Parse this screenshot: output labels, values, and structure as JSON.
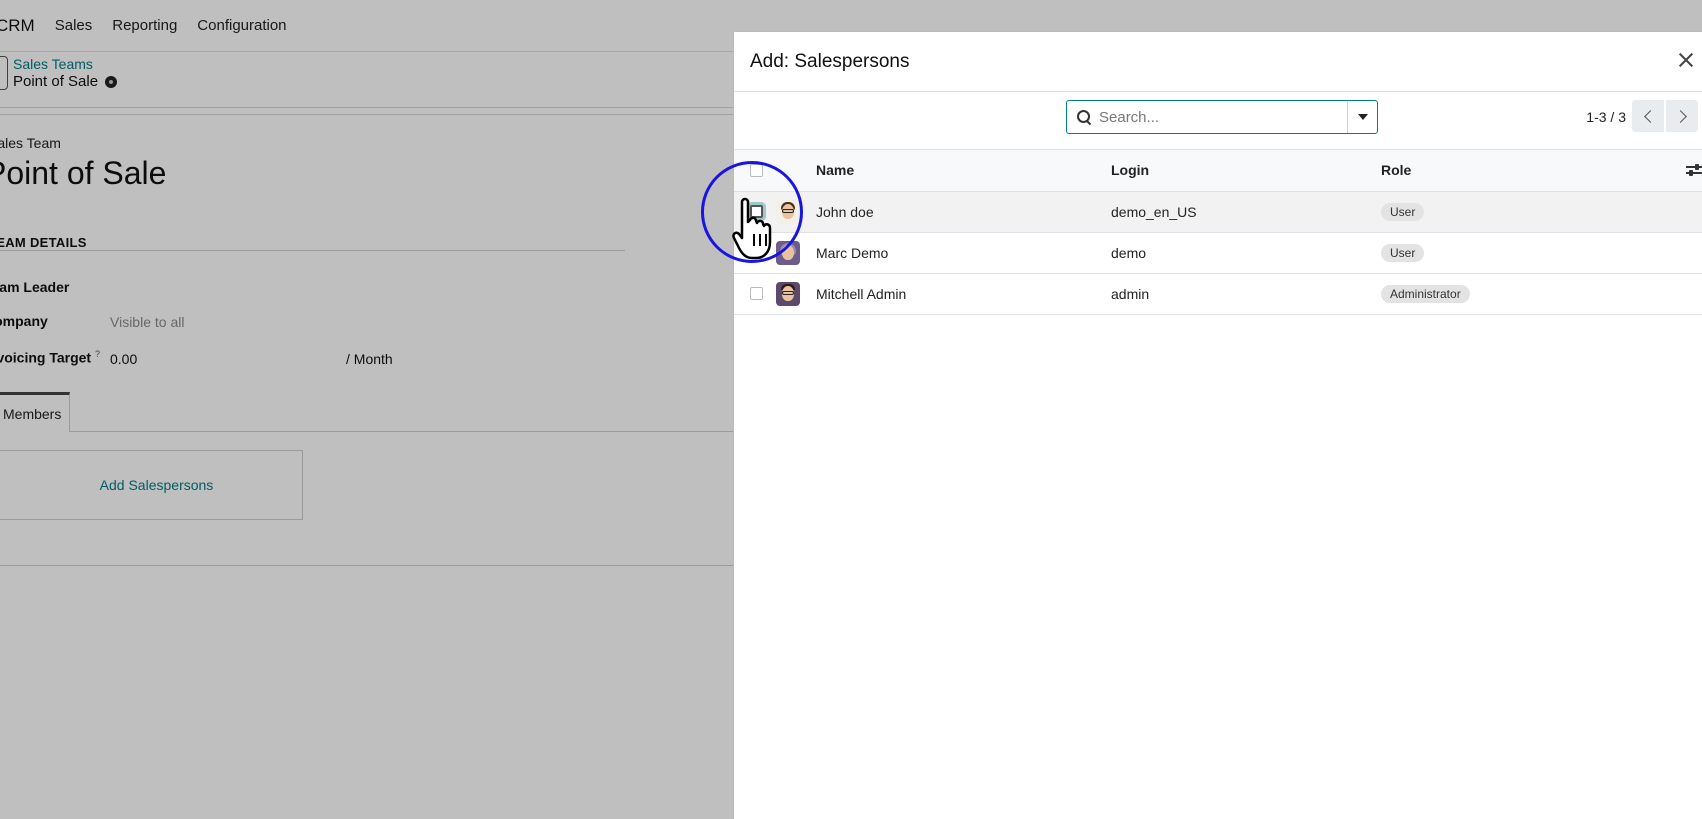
{
  "topnav": {
    "app_name": "CRM",
    "menus": [
      "Sales",
      "Reporting",
      "Configuration"
    ]
  },
  "breadcrumb": {
    "parent": "Sales Teams",
    "current": "Point of Sale"
  },
  "form": {
    "record_type_label": "Sales Team",
    "title": "Point of Sale",
    "section_title": "TEAM DETAILS",
    "team_leader_label": "Team Leader",
    "company_label": "Company",
    "company_value": "Visible to all",
    "invoicing_target_label": "Invoicing Target",
    "invoicing_target_help": "?",
    "invoicing_target_value": "0.00",
    "invoicing_target_unit": "/ Month",
    "tab_members": "Members",
    "add_salespersons": "Add Salespersons"
  },
  "dialog": {
    "title": "Add: Salespersons",
    "search_placeholder": "Search...",
    "pager": "1-3 / 3",
    "columns": {
      "name": "Name",
      "login": "Login",
      "role": "Role"
    },
    "rows": [
      {
        "name": "John doe",
        "login": "demo_en_US",
        "role": "User",
        "avatar": "avatar-john-doe"
      },
      {
        "name": "Marc Demo",
        "login": "demo",
        "role": "User",
        "avatar": "avatar-marc-demo"
      },
      {
        "name": "Mitchell Admin",
        "login": "admin",
        "role": "Administrator",
        "avatar": "avatar-mitchell-admin"
      }
    ]
  },
  "colors": {
    "accent": "#017e84",
    "cursor_ring": "#1a14e0",
    "badge_bg": "#e3e3e3"
  },
  "icons": [
    "search-icon",
    "caret-down-icon",
    "chevron-left-icon",
    "chevron-right-icon",
    "close-icon",
    "gear-icon",
    "optional-columns-icon",
    "hand-cursor-icon"
  ]
}
